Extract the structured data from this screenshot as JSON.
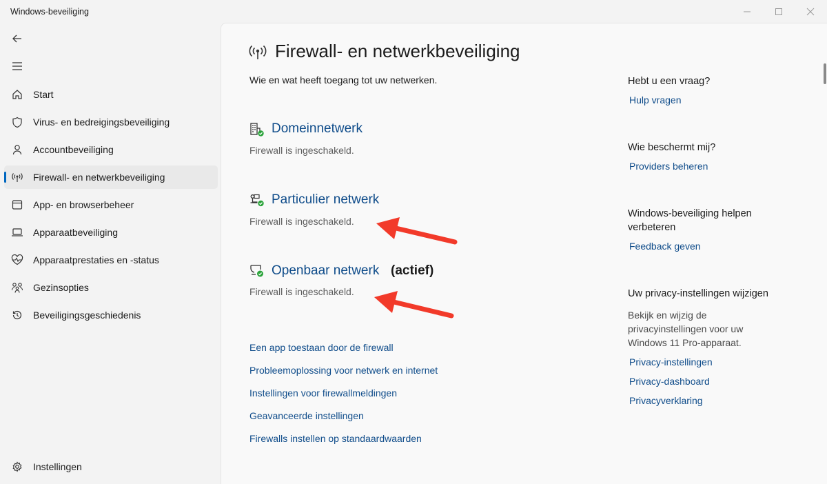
{
  "window": {
    "title": "Windows-beveiliging",
    "minimize_icon": "minimize-icon",
    "maximize_icon": "maximize-icon",
    "close_icon": "close-icon"
  },
  "nav": {
    "back_icon": "back-arrow-icon",
    "menu_icon": "hamburger-menu-icon"
  },
  "sidebar": {
    "items": [
      {
        "label": "Start",
        "icon": "home-icon"
      },
      {
        "label": "Virus- en bedreigingsbeveiliging",
        "icon": "shield-icon"
      },
      {
        "label": "Accountbeveiliging",
        "icon": "person-icon"
      },
      {
        "label": "Firewall- en netwerkbeveiliging",
        "icon": "antenna-icon",
        "selected": true
      },
      {
        "label": "App- en browserbeheer",
        "icon": "browser-window-icon"
      },
      {
        "label": "Apparaatbeveiliging",
        "icon": "laptop-icon"
      },
      {
        "label": "Apparaatprestaties en -status",
        "icon": "heart-pulse-icon"
      },
      {
        "label": "Gezinsopties",
        "icon": "family-icon"
      },
      {
        "label": "Beveiligingsgeschiedenis",
        "icon": "history-icon"
      }
    ],
    "settings": {
      "label": "Instellingen",
      "icon": "gear-icon"
    }
  },
  "main": {
    "title": "Firewall- en netwerkbeveiliging",
    "subtitle": "Wie en wat heeft toegang tot uw netwerken.",
    "networks": [
      {
        "name": "Domeinnetwerk",
        "status": "Firewall is ingeschakeld.",
        "icon": "domain-network-icon",
        "active_label": ""
      },
      {
        "name": "Particulier netwerk",
        "status": "Firewall is ingeschakeld.",
        "icon": "private-network-icon",
        "active_label": ""
      },
      {
        "name": "Openbaar netwerk",
        "status": "Firewall is ingeschakeld.",
        "icon": "public-network-icon",
        "active_label": "(actief)"
      }
    ],
    "links": [
      "Een app toestaan door de firewall",
      "Probleemoplossing voor netwerk en internet",
      "Instellingen voor firewallmeldingen",
      "Geavanceerde instellingen",
      "Firewalls instellen op standaardwaarden"
    ]
  },
  "aside": {
    "help_heading": "Hebt u een vraag?",
    "help_link": "Hulp vragen",
    "protect_heading": "Wie beschermt mij?",
    "protect_link": "Providers beheren",
    "improve_heading": "Windows-beveiliging helpen verbeteren",
    "improve_link": "Feedback geven",
    "privacy_heading": "Uw privacy-instellingen wijzigen",
    "privacy_text": "Bekijk en wijzig de privacyinstellingen voor uw Windows 11 Pro-apparaat.",
    "privacy_links": [
      "Privacy-instellingen",
      "Privacy-dashboard",
      "Privacyverklaring"
    ]
  },
  "colors": {
    "accent": "#0067c0",
    "link": "#0f4c8a",
    "annotation_arrow": "#f23a2a",
    "status_ok": "#2aa33a"
  }
}
